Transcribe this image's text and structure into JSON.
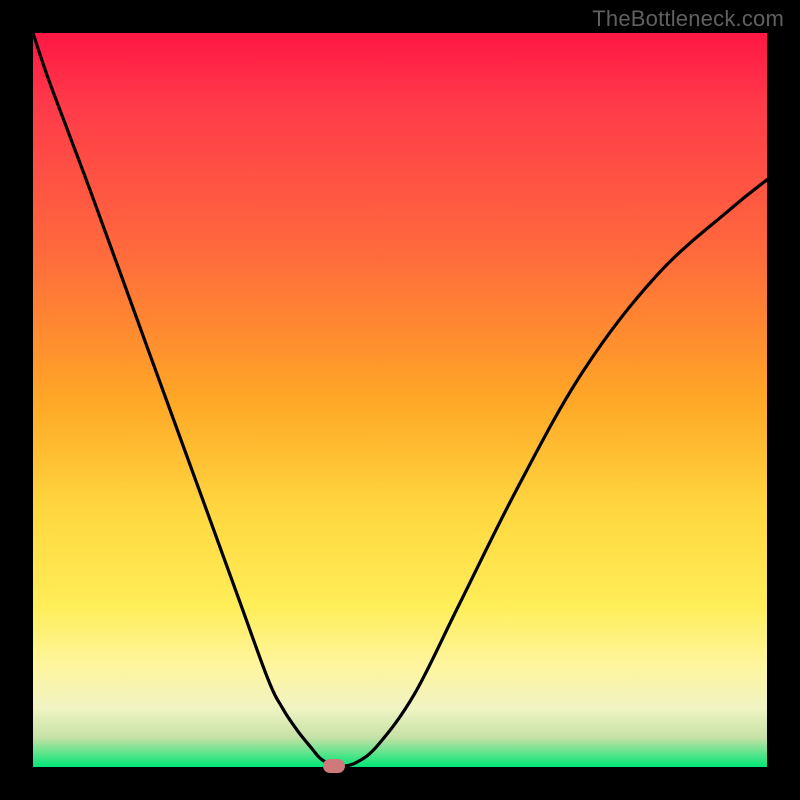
{
  "watermark": "TheBottleneck.com",
  "colors": {
    "frame": "#000000",
    "gradient_top": "#ff1744",
    "gradient_mid": "#ffd740",
    "gradient_bottom": "#00e676",
    "curve": "#000000",
    "marker": "#cf7a7a"
  },
  "chart_data": {
    "type": "line",
    "title": "",
    "xlabel": "",
    "ylabel": "",
    "xlim": [
      0,
      100
    ],
    "ylim": [
      0,
      100
    ],
    "grid": false,
    "legend": false,
    "x": [
      0,
      2,
      5,
      8,
      12,
      16,
      20,
      24,
      28,
      32,
      34,
      36,
      38,
      39,
      40,
      41,
      42,
      44,
      47,
      52,
      58,
      66,
      75,
      85,
      95,
      100
    ],
    "y": [
      100,
      94,
      86,
      78,
      67,
      56,
      45,
      34,
      23,
      12,
      8,
      5,
      2.5,
      1.3,
      0.6,
      0.2,
      0.1,
      0.6,
      3,
      10,
      22,
      38,
      54,
      67,
      76,
      80
    ],
    "min_marker": {
      "x": 41,
      "y": 0.1
    },
    "notes": "V-shaped bottleneck curve; minimum ≈ x=41. Background is vertical rainbow gradient (red top → green bottom). Axes unlabeled; values are relative 0–100 estimates from pixel positions."
  }
}
